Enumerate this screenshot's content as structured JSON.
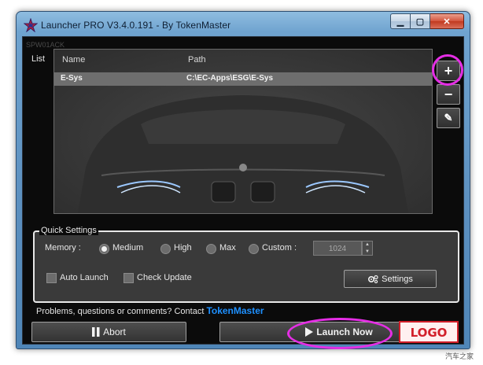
{
  "window": {
    "title": "Launcher PRO V3.4.0.191 - By TokenMaster",
    "min_glyph": "▁",
    "max_glyph": "▢",
    "close_glyph": "✕"
  },
  "watermark_small": "SPW01ACK",
  "list": {
    "label": "List",
    "columns": [
      "Name",
      "Path"
    ],
    "rows": [
      {
        "name": "E-Sys",
        "path": "C:\\EC-Apps\\ESG\\E-Sys"
      }
    ]
  },
  "side_buttons": {
    "add_glyph": "+",
    "remove_glyph": "−",
    "edit_glyph": "✎"
  },
  "quick_settings": {
    "legend": "Quick Settings",
    "memory_label": "Memory :",
    "memory_options": [
      {
        "label": "Medium",
        "selected": true
      },
      {
        "label": "High",
        "selected": false
      },
      {
        "label": "Max",
        "selected": false
      },
      {
        "label": "Custom :",
        "selected": false
      }
    ],
    "custom_value": "1024",
    "auto_launch_label": "Auto Launch",
    "auto_launch_checked": false,
    "check_update_label": "Check Update",
    "check_update_checked": false,
    "settings_label": "Settings"
  },
  "contact": {
    "text": "Problems, questions or comments? Contact",
    "link": "TokenMaster"
  },
  "actions": {
    "abort_label": "Abort",
    "launch_label": "Launch Now"
  },
  "corner_watermark": "汽车之家",
  "colors": {
    "accent_link": "#1e90ff",
    "highlight": "#e52ee5"
  }
}
